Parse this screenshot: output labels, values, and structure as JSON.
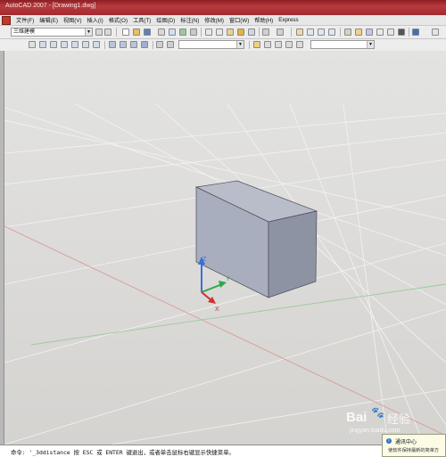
{
  "window": {
    "title": "AutoCAD 2007 - [Drawing1.dwg]",
    "accent": "#a92d33"
  },
  "menu": {
    "items": [
      "文件(F)",
      "编辑(E)",
      "视图(V)",
      "插入(I)",
      "格式(O)",
      "工具(T)",
      "绘图(D)",
      "标注(N)",
      "修改(M)",
      "窗口(W)",
      "帮助(H)",
      "Express"
    ]
  },
  "toolbar": {
    "workspace": "三维建模",
    "layer_combo": "",
    "icons": [
      "new-icon",
      "open-icon",
      "save-icon",
      "plot-icon",
      "preview-icon",
      "publish-icon",
      "cut-icon",
      "copy-icon",
      "paste-icon",
      "match-properties-icon",
      "undo-icon",
      "redo-icon",
      "pan-icon",
      "zoom-realtime-icon",
      "zoom-window-icon",
      "zoom-previous-icon",
      "properties-icon",
      "design-center-icon",
      "tool-palettes-icon",
      "calculator-icon",
      "help-icon"
    ]
  },
  "toolbar2": {
    "icons": [
      "box-icon",
      "wedge-icon",
      "cone-icon",
      "sphere-icon",
      "cylinder-icon",
      "torus-icon",
      "union-icon",
      "subtract-icon",
      "intersect-icon",
      "extrude-icon",
      "revolve-icon",
      "shade-icon"
    ],
    "style_combo": ""
  },
  "viewport": {
    "ucs": {
      "x": "X",
      "y": "Y",
      "z": "Z"
    },
    "solid_color": "#a7adbd"
  },
  "command": {
    "text": "命令: '_3ddistance 按 ESC 或 ENTER 键退出，或者单击鼠标右键显示快捷菜单。"
  },
  "notification": {
    "title": "通讯中心",
    "body": "使软件保持最新的简单方"
  },
  "watermark": {
    "brand": "Bai",
    "suffix": "经验",
    "url": "jingyan.baidu.com"
  }
}
